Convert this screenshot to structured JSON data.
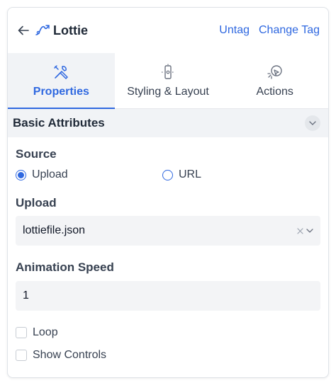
{
  "header": {
    "title": "Lottie",
    "untag_label": "Untag",
    "change_tag_label": "Change Tag"
  },
  "tabs": [
    {
      "label": "Properties",
      "icon": "tools-icon",
      "active": true
    },
    {
      "label": "Styling & Layout",
      "icon": "device-icon",
      "active": false
    },
    {
      "label": "Actions",
      "icon": "cursor-click-icon",
      "active": false
    }
  ],
  "section": {
    "title": "Basic Attributes"
  },
  "source": {
    "label": "Source",
    "options": [
      {
        "label": "Upload",
        "checked": true
      },
      {
        "label": "URL",
        "checked": false
      }
    ]
  },
  "upload": {
    "label": "Upload",
    "selected_value": "lottiefile.json"
  },
  "animation_speed": {
    "label": "Animation Speed",
    "value": "1"
  },
  "checkboxes": [
    {
      "label": "Loop",
      "checked": false
    },
    {
      "label": "Show Controls",
      "checked": false
    }
  ],
  "colors": {
    "accent": "#2f68e0",
    "text": "#1f2937",
    "muted_bg": "#f1f3f6"
  }
}
